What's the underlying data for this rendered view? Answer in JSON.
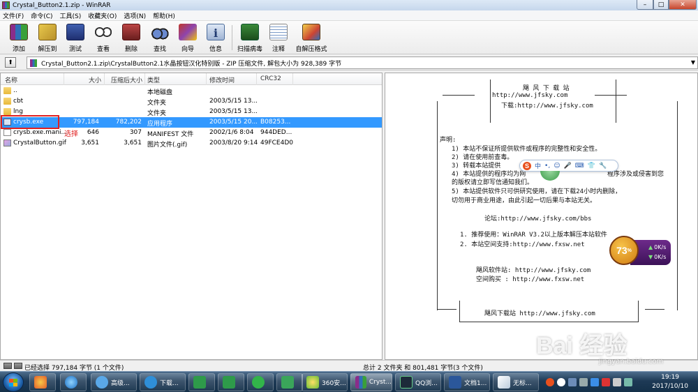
{
  "window": {
    "title": "Crystal_Button2.1.zip - WinRAR",
    "min": "–",
    "max": "□",
    "close": "✕"
  },
  "menu": [
    "文件(F)",
    "命令(C)",
    "工具(S)",
    "收藏夹(O)",
    "选项(N)",
    "帮助(H)"
  ],
  "toolbar": {
    "add": "添加",
    "extract": "解压到",
    "test": "测试",
    "view": "查看",
    "delete": "删除",
    "find": "查找",
    "wizard": "向导",
    "info": "信息",
    "virus": "扫描病毒",
    "comment": "注释",
    "sfx": "自解压格式"
  },
  "address": {
    "up": "⬆",
    "path": "Crystal_Button2.1.zip\\CrystalButton2.1水晶按钮汉化特别版 - ZIP 压缩文件, 解包大小为 928,389 字节",
    "drop": "▼"
  },
  "columns": {
    "name": "名称",
    "size": "大小",
    "packed": "压缩后大小",
    "type": "类型",
    "modified": "修改时间",
    "crc": "CRC32"
  },
  "files": [
    {
      "name": "..",
      "size": "",
      "packed": "",
      "type": "本地磁盘",
      "modified": "",
      "crc": ""
    },
    {
      "name": "cbt",
      "size": "",
      "packed": "",
      "type": "文件夹",
      "modified": "2003/5/15 13...",
      "crc": ""
    },
    {
      "name": "lng",
      "size": "",
      "packed": "",
      "type": "文件夹",
      "modified": "2003/5/15 13...",
      "crc": ""
    },
    {
      "name": "crysb.exe",
      "size": "797,184",
      "packed": "782,202",
      "type": "应用程序",
      "modified": "2003/5/15 20...",
      "crc": "B08253..."
    },
    {
      "name": "crysb.exe.mani...",
      "size": "646",
      "packed": "307",
      "type": "MANIFEST 文件",
      "modified": "2002/1/6 8:04",
      "crc": "944DED..."
    },
    {
      "name": "CrystalButton.gif",
      "size": "3,651",
      "packed": "3,651",
      "type": "图片文件(.gif)",
      "modified": "2003/8/20 9:14",
      "crc": "49FCE4D0"
    }
  ],
  "annotation": "选择",
  "preview": {
    "header1": "飓 风 下 载 站",
    "header2": "http://www.jfsky.com",
    "header3": "下载:http://www.jfsky.com",
    "decl": "声明:",
    "items": [
      "1)  本站不保证所提供软件或程序的完整性和安全性。",
      "2)  请在使用前查毒。",
      "3)  转载本站提供",
      "4)  本站提供的程序均为网",
      "    的版权请立即写信通知我们。",
      "5)  本站提供软件只可供研究使用，请在下载24小时内删除，",
      "    切勿用于商业用途，由此引起一切后果与本站无关。"
    ],
    "item4_tail": "程序涉及或侵害到您",
    "forum": "论坛:http://www.jfsky.com/bbs",
    "recommend1": "1. 推荐使用：WinRAR V3.2以上版本解压本站软件",
    "recommend2": "2. 本站空间支持:http://www.fxsw.net",
    "site1": "飓风软件站: http://www.jfsky.com",
    "site2": "空间购买  : http://www.fxsw.net",
    "footer": "飓风下载站 http://www.jfsky.com"
  },
  "ime": {
    "logo": "S",
    "mode": "中",
    "punct": "•,",
    "emoji": "☺",
    "voice": "🎤",
    "keyboard": "⌨",
    "skin": "👕",
    "tool": "🔧"
  },
  "speed": {
    "percent": "73",
    "unit": "%",
    "up": "0K/s",
    "down": "0K/s"
  },
  "status": {
    "left": "已经选择 797,184 字节 (1 个文件)",
    "right": "总计 2 文件夹 和 801,481 字节(3 个文件)"
  },
  "taskbar": {
    "items": [
      "高级...",
      "下载...",
      "",
      "",
      "",
      "",
      "360安...",
      "Cryst...",
      "QQ浏...",
      "文档1...",
      "无标..."
    ],
    "time": "19:19",
    "date": "2017/10/10"
  },
  "watermark": {
    "main": "Bai 经验",
    "sub": "jingyan.baidu.com"
  }
}
